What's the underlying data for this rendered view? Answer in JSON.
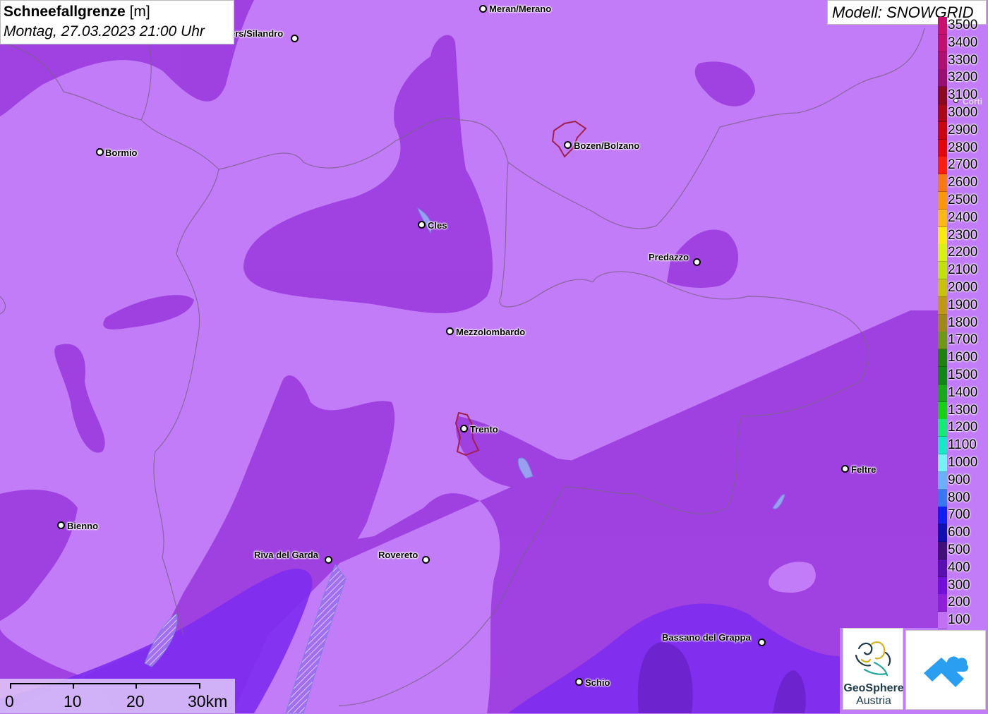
{
  "title": {
    "name": "Schneefallgrenze",
    "unit": "[m]",
    "datetime": "Montag, 27.03.2023 21:00 Uhr"
  },
  "model": {
    "label": "Modell: SNOWGRID"
  },
  "legend": {
    "items": [
      {
        "label": "3500",
        "color": "#c8106e"
      },
      {
        "label": "3400",
        "color": "#c01070"
      },
      {
        "label": "3300",
        "color": "#b01070"
      },
      {
        "label": "3200",
        "color": "#9a1070"
      },
      {
        "label": "3100",
        "color": "#8a0a20"
      },
      {
        "label": "3000",
        "color": "#a80a18"
      },
      {
        "label": "2900",
        "color": "#c80810"
      },
      {
        "label": "2800",
        "color": "#e00808"
      },
      {
        "label": "2700",
        "color": "#f82010"
      },
      {
        "label": "2600",
        "color": "#f87818"
      },
      {
        "label": "2500",
        "color": "#f89810"
      },
      {
        "label": "2400",
        "color": "#f8b818"
      },
      {
        "label": "2300",
        "color": "#f8e818"
      },
      {
        "label": "2200",
        "color": "#d8f018"
      },
      {
        "label": "2100",
        "color": "#c0e010"
      },
      {
        "label": "2000",
        "color": "#c8c010"
      },
      {
        "label": "1900",
        "color": "#c09818"
      },
      {
        "label": "1800",
        "color": "#a08818"
      },
      {
        "label": "1700",
        "color": "#709818"
      },
      {
        "label": "1600",
        "color": "#208010"
      },
      {
        "label": "1500",
        "color": "#108818"
      },
      {
        "label": "1400",
        "color": "#18a818"
      },
      {
        "label": "1300",
        "color": "#18d018"
      },
      {
        "label": "1200",
        "color": "#18e878"
      },
      {
        "label": "1100",
        "color": "#18e8c8"
      },
      {
        "label": "1000",
        "color": "#78f0f8"
      },
      {
        "label": "900",
        "color": "#68b0f8"
      },
      {
        "label": "800",
        "color": "#3878f0"
      },
      {
        "label": "700",
        "color": "#1020f0"
      },
      {
        "label": "600",
        "color": "#1010b0"
      },
      {
        "label": "500",
        "color": "#401078"
      },
      {
        "label": "400",
        "color": "#5810b0"
      },
      {
        "label": "300",
        "color": "#7010d8"
      },
      {
        "label": "200",
        "color": "#9020d8"
      },
      {
        "label": "100",
        "color": "#c070f0"
      }
    ]
  },
  "cities": [
    {
      "name": "Meran/Merano"
    },
    {
      "name": "ers/Silandro"
    },
    {
      "name": "Bormio"
    },
    {
      "name": "Bozen/Bolzano"
    },
    {
      "name": "Cles"
    },
    {
      "name": "Predazzo"
    },
    {
      "name": "Mezzolombardo"
    },
    {
      "name": "Trento"
    },
    {
      "name": "Feltre"
    },
    {
      "name": "Bienno"
    },
    {
      "name": "Riva del Garda"
    },
    {
      "name": "Rovereto"
    },
    {
      "name": "Bassano del Grappa"
    },
    {
      "name": "Schio"
    },
    {
      "name": "Corti"
    }
  ],
  "scale": {
    "labels": [
      "0",
      "10",
      "20",
      "30km"
    ]
  },
  "logos": {
    "geosphere_line1": "GeoSphere",
    "geosphere_line2": "Austria"
  },
  "colors": {
    "light_purple": "#c27cf7",
    "mid_purple": "#9e3ee0",
    "dark_purple": "#8a2ad8",
    "violet": "#7d2cf0"
  }
}
